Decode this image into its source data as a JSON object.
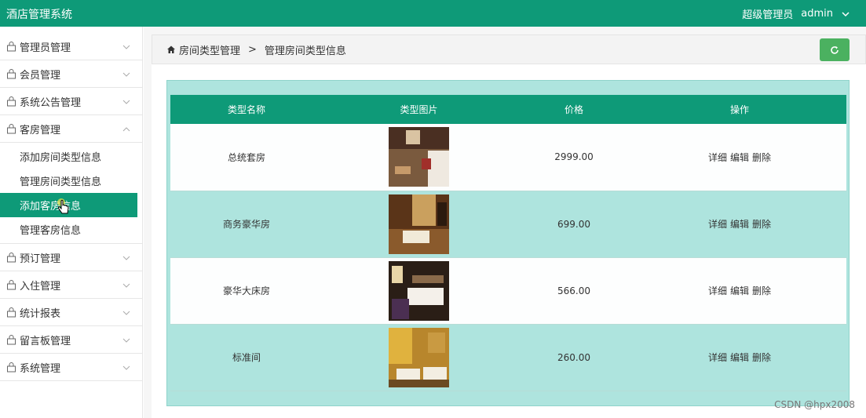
{
  "app": {
    "title": "酒店管理系统",
    "role": "超级管理员",
    "username": "admin"
  },
  "sidebar": {
    "items_top": [
      {
        "label": "管理员管理"
      },
      {
        "label": "会员管理"
      },
      {
        "label": "系统公告管理"
      },
      {
        "label": "客房管理"
      }
    ],
    "sub_items": [
      {
        "label": "添加房间类型信息"
      },
      {
        "label": "管理房间类型信息"
      },
      {
        "label": "添加客房信息"
      },
      {
        "label": "管理客房信息"
      }
    ],
    "items_bottom": [
      {
        "label": "预订管理"
      },
      {
        "label": "入住管理"
      },
      {
        "label": "统计报表"
      },
      {
        "label": "留言板管理"
      },
      {
        "label": "系统管理"
      }
    ]
  },
  "breadcrumb": {
    "first": "房间类型管理",
    "separator": ">",
    "current": "管理房间类型信息"
  },
  "table": {
    "headers": [
      "类型名称",
      "类型图片",
      "价格",
      "操作"
    ],
    "rows": [
      {
        "name": "总统套房",
        "price": "2999.00"
      },
      {
        "name": "商务豪华房",
        "price": "699.00"
      },
      {
        "name": "豪华大床房",
        "price": "566.00"
      },
      {
        "name": "标准间",
        "price": "260.00"
      }
    ],
    "actions": {
      "detail": "详细",
      "edit": "编辑",
      "delete": "删除"
    }
  },
  "watermark": "CSDN @hpx2008",
  "colors": {
    "primary": "#0e9a78",
    "panel": "#aee4de",
    "refresh": "#4bb160"
  }
}
